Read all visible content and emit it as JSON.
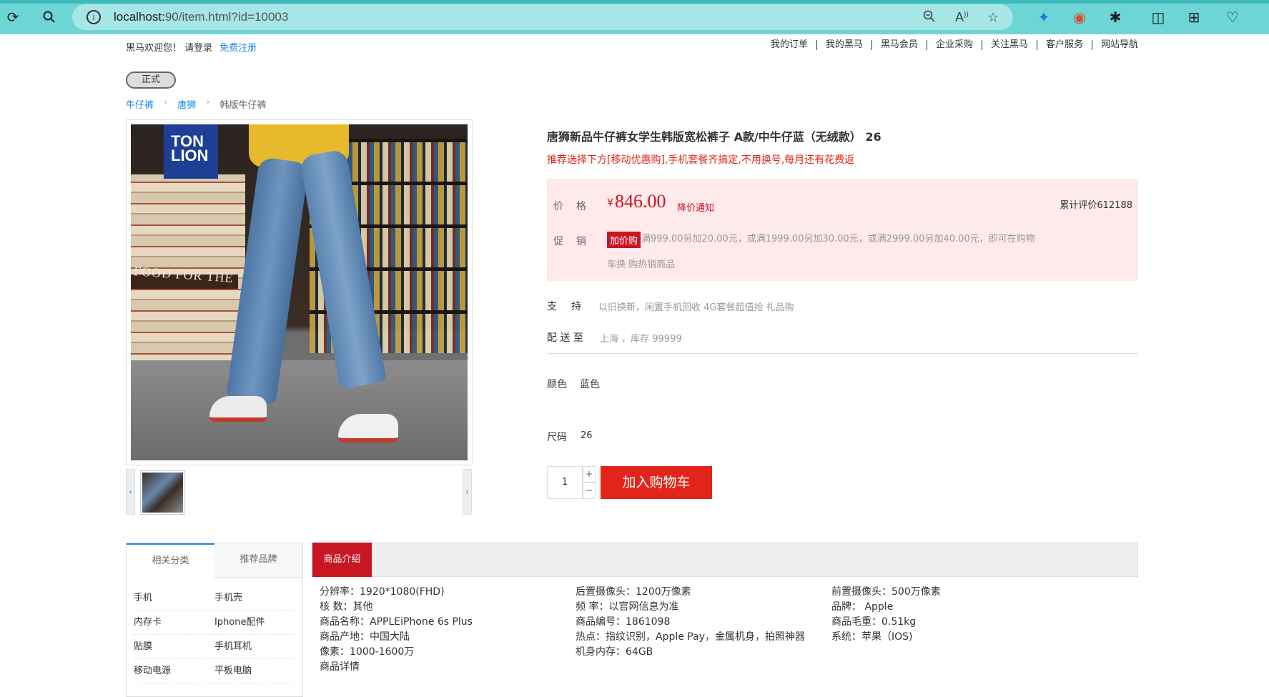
{
  "browser": {
    "url_host": "localhost:",
    "url_port_path": "90/item.html?id=10003"
  },
  "topnav": {
    "welcome": "黑马欢迎您！ 请登录",
    "register": "免费注册",
    "links": [
      "我的订单",
      "我的黑马",
      "黑马会员",
      "企业采购",
      "关注黑马",
      "客户服务",
      "网站导航"
    ]
  },
  "tag_button": "正式",
  "breadcrumb": [
    "牛仔裤",
    "唐狮",
    "韩版牛仔裤"
  ],
  "product_image": {
    "logo_line1": "TON",
    "logo_line2": "LION",
    "scene_text": "FOOD FOR THE"
  },
  "product": {
    "title": "唐狮新品牛仔裤女学生韩版宽松裤子 A款/中牛仔蓝（无绒款） 26",
    "promo_text": "推荐选择下方[移动优惠购],手机套餐齐搞定,不用换号,每月还有花费返",
    "price_label": "价格",
    "currency": "¥",
    "price": "846.00",
    "price_note": "降价通知",
    "reviews": "累计评价612188",
    "promo_label": "促销",
    "promo_badge": "加价购",
    "promo_desc": "满999.00另加20.00元，或满1999.00另加30.00元，或满2999.00另加40.00元，即可在购物",
    "promo_desc2": "车换 购热销商品",
    "support_label": "支持",
    "support_value": "以旧换新，闲置手机回收 4G套餐超值抢 礼品购",
    "ship_label": "配 送 至",
    "ship_value": "上海 ，库存 99999",
    "color_label": "颜色",
    "color_value": "蓝色",
    "size_label": "尺码",
    "size_value": "26",
    "quantity": "1",
    "plus": "+",
    "minus": "−",
    "add_to_cart": "加入购物车"
  },
  "sidebar": {
    "tabs": [
      "相关分类",
      "推荐品牌"
    ],
    "items": [
      [
        "手机",
        "手机壳"
      ],
      [
        "内存卡",
        "Iphone配件"
      ],
      [
        "贴膜",
        "手机耳机"
      ],
      [
        "移动电源",
        "平板电脑"
      ]
    ]
  },
  "intro": {
    "tab": "商品介绍",
    "col1": [
      "分辨率：1920*1080(FHD)",
      "核 数：其他",
      "商品名称：APPLEiPhone 6s Plus",
      "商品产地：中国大陆",
      "像素：1000-1600万",
      "商品详情"
    ],
    "col2": [
      "后置摄像头：1200万像素",
      "频 率：以官网信息为准",
      "商品编号：1861098",
      "热点：指纹识别，Apple Pay，金属机身，拍照神器",
      "机身内存：64GB"
    ],
    "col3": [
      "前置摄像头：500万像素",
      "品牌：  Apple",
      "商品毛重：0.51kg",
      "系统：苹果（IOS)"
    ]
  }
}
